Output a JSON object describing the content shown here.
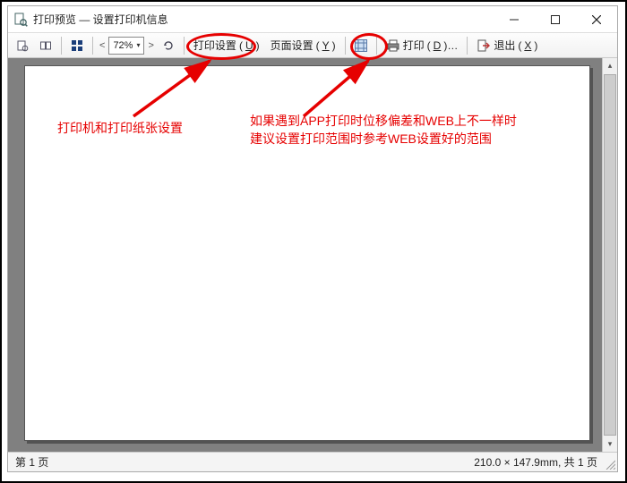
{
  "window": {
    "title": "打印预览 — 设置打印机信息"
  },
  "toolbar": {
    "zoom_value": "72%",
    "print_setup_label": "打印设置",
    "print_setup_key": "U",
    "page_setup_label": "页面设置",
    "page_setup_key": "Y",
    "print_label": "打印",
    "print_key": "D",
    "exit_label": "退出",
    "exit_key": "X"
  },
  "status": {
    "left": "第 1 页",
    "right": "210.0 × 147.9mm, 共 1 页"
  },
  "annotations": {
    "left_text": "打印机和打印纸张设置",
    "right_line1": "如果遇到APP打印时位移偏差和WEB上不一样时",
    "right_line2": "建议设置打印范围时参考WEB设置好的范围"
  }
}
